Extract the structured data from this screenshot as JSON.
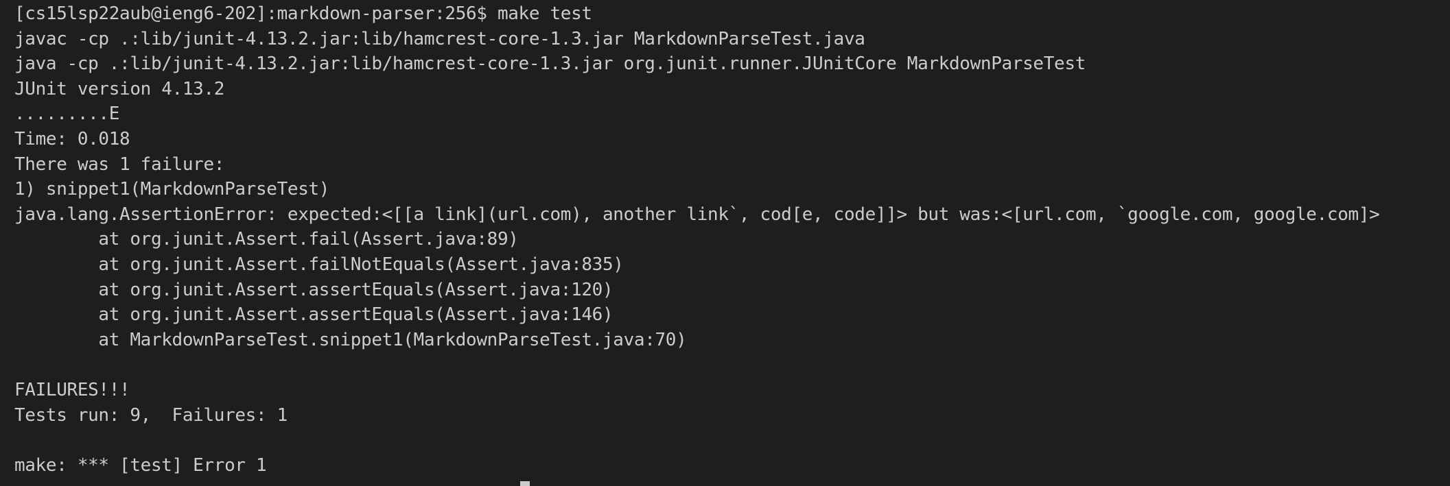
{
  "terminal": {
    "lines": [
      "[cs15lsp22aub@ieng6-202]:markdown-parser:256$ make test",
      "javac -cp .:lib/junit-4.13.2.jar:lib/hamcrest-core-1.3.jar MarkdownParseTest.java",
      "java -cp .:lib/junit-4.13.2.jar:lib/hamcrest-core-1.3.jar org.junit.runner.JUnitCore MarkdownParseTest",
      "JUnit version 4.13.2",
      ".........E",
      "Time: 0.018",
      "There was 1 failure:",
      "1) snippet1(MarkdownParseTest)",
      "java.lang.AssertionError: expected:<[[a link](url.com), another link`, cod[e, code]]> but was:<[url.com, `google.com, google.com]>",
      "        at org.junit.Assert.fail(Assert.java:89)",
      "        at org.junit.Assert.failNotEquals(Assert.java:835)",
      "        at org.junit.Assert.assertEquals(Assert.java:120)",
      "        at org.junit.Assert.assertEquals(Assert.java:146)",
      "        at MarkdownParseTest.snippet1(MarkdownParseTest.java:70)",
      "",
      "FAILURES!!!",
      "Tests run: 9,  Failures: 1",
      "",
      "make: *** [test] Error 1"
    ]
  }
}
